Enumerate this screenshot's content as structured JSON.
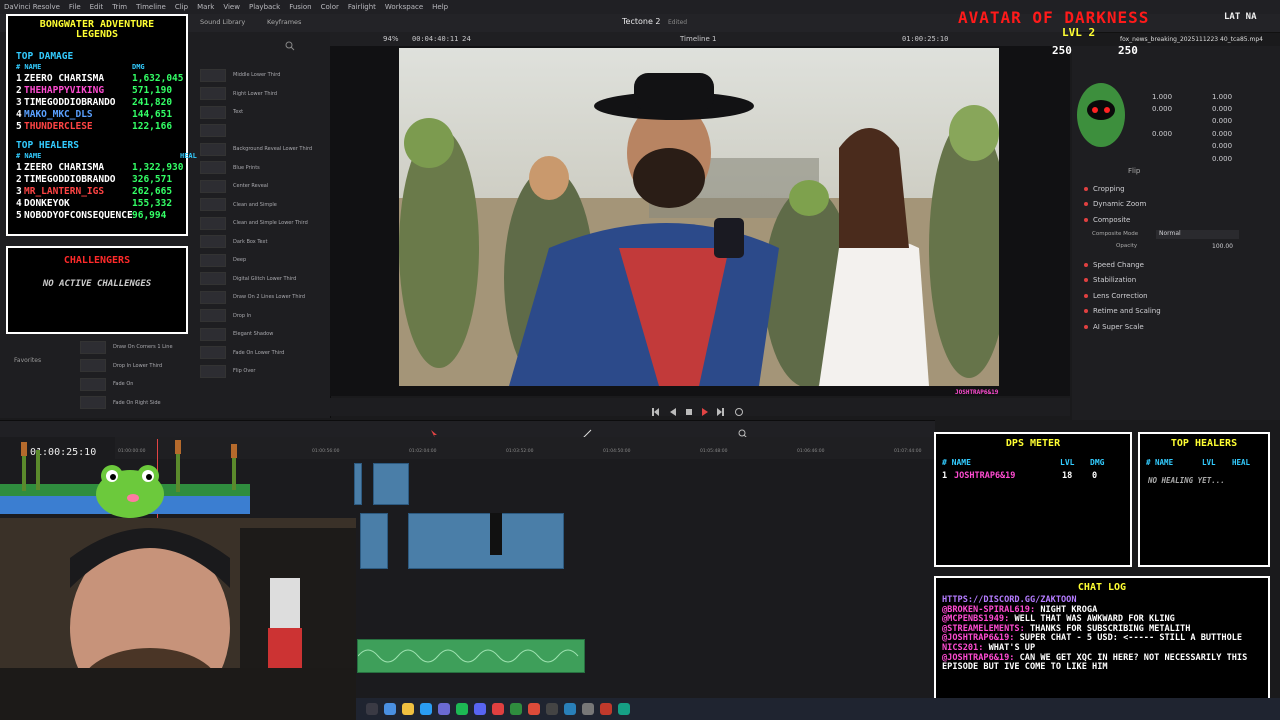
{
  "app": {
    "menu": [
      "DaVinci Resolve",
      "File",
      "Edit",
      "Trim",
      "Timeline",
      "Clip",
      "Mark",
      "View",
      "Playback",
      "Fusion",
      "Color",
      "Fairlight",
      "Workspace",
      "Help"
    ],
    "project_title": "Tectone 2",
    "edited_label": "Edited",
    "toolbar_items": [
      "Sound Library",
      "Keyframes"
    ]
  },
  "viewer": {
    "zoom": "94%",
    "timecode_left": "00:04:40:11",
    "fps": "24",
    "timeline_name": "Timeline 1",
    "timecode_right": "01:00:25:10",
    "clip_name": "fox_news_breaking_2025111223 40_tca85.mp4",
    "watermark_user": "JOSHTRAP6&19"
  },
  "effects": {
    "left_col": [
      "",
      "",
      "",
      "",
      "",
      "",
      "",
      "",
      "",
      "",
      "Draw On Corners 1 Line",
      "Drop In Lower Third",
      "Fade On",
      "Fade On Right Side"
    ],
    "right_col": [
      "Middle Lower Third",
      "Right Lower Third",
      "Text",
      "",
      "Background Reveal Lower Third",
      "Blue Prints",
      "Center Reveal",
      "Clean and Simple",
      "Clean and Simple Lower Third",
      "Dark Box Text",
      "Deep",
      "Digital Glitch Lower Third",
      "Draw On 2 Lines Lower Third",
      "Drop In",
      "Elegant Shadow",
      "Fade On Lower Third",
      "Flip Over"
    ],
    "favorites_label": "Favorites"
  },
  "inspector": {
    "zoom_x": "1.000",
    "zoom_y": "1.000",
    "pos_x": "0.000",
    "pos_y": "0.000",
    "rot": "0.000",
    "anchor_x": "0.000",
    "anchor_y": "0.000",
    "pitch": "0.000",
    "yaw": "0.000",
    "flip_label": "Flip",
    "sections": [
      "Cropping",
      "Dynamic Zoom",
      "Composite",
      "Speed Change",
      "Stabilization",
      "Lens Correction",
      "Retime and Scaling",
      "AI Super Scale"
    ],
    "composite_mode_label": "Composite Mode",
    "composite_mode_value": "Normal",
    "opacity_label": "Opacity",
    "opacity_value": "100.00"
  },
  "timeline": {
    "timecode": "01:00:25:10",
    "ruler": [
      "01:00:00:00",
      "01:00:56:00",
      "01:02:04:00",
      "01:03:52:00",
      "01:04:50:00",
      "01:05:48:00",
      "01:06:46:00",
      "01:07:44:00"
    ]
  },
  "overlay_top_left": {
    "title_line1": "BONGWATER ADVENTURE",
    "title_line2": "LEGENDS",
    "damage_header": "TOP DAMAGE",
    "col_name": "# NAME",
    "col_dmg": "DMG",
    "damage_rows": [
      {
        "rank": "1",
        "name": "ZEERO CHARISMA",
        "value": "1,632,045",
        "color": "#ffffff"
      },
      {
        "rank": "2",
        "name": "THEHAPPYVIKING",
        "value": "571,190",
        "color": "#ff4cd2"
      },
      {
        "rank": "3",
        "name": "TIMEGODDIOBRANDO",
        "value": "241,820",
        "color": "#ffffff"
      },
      {
        "rank": "4",
        "name": "MAKO_MKC_DLS",
        "value": "144,651",
        "color": "#5aa0ff"
      },
      {
        "rank": "5",
        "name": "THUNDERCLESE",
        "value": "122,166",
        "color": "#ff4444"
      }
    ],
    "healers_header": "TOP HEALERS",
    "col_heal": "HEAL",
    "healer_rows": [
      {
        "rank": "1",
        "name": "ZEERO CHARISMA",
        "value": "1,322,930",
        "color": "#ffffff"
      },
      {
        "rank": "2",
        "name": "TIMEGODDIOBRANDO",
        "value": "326,571",
        "color": "#ffffff"
      },
      {
        "rank": "3",
        "name": "MR_LANTERN_IGS",
        "value": "262,665",
        "color": "#ff4444"
      },
      {
        "rank": "4",
        "name": "DONKEYOK",
        "value": "155,332",
        "color": "#ffffff"
      },
      {
        "rank": "5",
        "name": "NOBODYOFCONSEQUENCE58",
        "value": "96,994",
        "color": "#ffffff"
      }
    ],
    "challengers_header": "CHALLENGERS",
    "challengers_empty": "NO ACTIVE CHALLENGES"
  },
  "overlay_top_right": {
    "banner": "AVATAR OF DARKNESS",
    "lvl": "LVL 2",
    "hp_left": "250",
    "hp_right": "250",
    "tag": "LAT NA"
  },
  "dps_meter": {
    "title": "DPS METER",
    "col_name": "# NAME",
    "col_lvl": "LVL",
    "col_dmg": "DMG",
    "rows": [
      {
        "rank": "1",
        "name": "JOSHTRAP6&19",
        "lvl": "18",
        "dmg": "0"
      }
    ]
  },
  "top_healers_box": {
    "title": "TOP HEALERS",
    "col_name": "# NAME",
    "col_lvl": "LVL",
    "col_heal": "HEAL",
    "empty": "NO HEALING YET..."
  },
  "chat_log": {
    "title": "CHAT LOG",
    "lines": [
      {
        "user": "HTTPS://DISCORD.GG/ZAKTOON",
        "text": "",
        "color": "#b57cff"
      },
      {
        "user": "@BROKEN-SPIRAL619:",
        "text": "NIGHT KROGA",
        "color": "#ff4cd2"
      },
      {
        "user": "@MCPENBS1949:",
        "text": "WELL THAT WAS AWKWARD FOR KLING",
        "color": "#ff4cd2"
      },
      {
        "user": "@STREAMELEMENTS:",
        "text": "THANKS FOR SUBSCRIBING METALITH",
        "color": "#ff4cd2"
      },
      {
        "user": "@JOSHTRAP6&19:",
        "text": "SUPER CHAT - 5 USD: <----- STILL A BUTTHOLE",
        "color": "#ff4cd2"
      },
      {
        "user": "NICS201:",
        "text": "WHAT'S UP",
        "color": "#ff4cd2"
      },
      {
        "user": "@JOSHTRAP6&19:",
        "text": "CAN WE GET XQC IN HERE? NOT NECESSARILY THIS EPISODE BUT IVE COME TO LIKE HIM",
        "color": "#ff4cd2"
      }
    ]
  },
  "colors": {
    "overlay_title": "#ffff33",
    "overlay_header": "#33ccff",
    "overlay_red": "#ff2a2a",
    "overlay_value": "#33ff66"
  }
}
